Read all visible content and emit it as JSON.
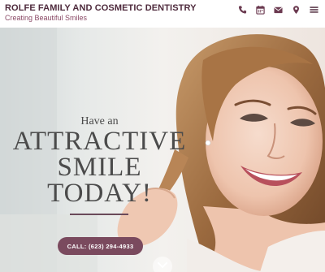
{
  "header": {
    "title": "ROLFE FAMILY AND COSMETIC DENTISTRY",
    "tagline": "Creating Beautiful Smiles",
    "icons": [
      "phone-icon",
      "calendar-icon",
      "envelope-icon",
      "map-pin-icon",
      "menu-icon"
    ]
  },
  "hero": {
    "kicker": "Have an",
    "line1": "ATTRACTIVE",
    "line2": "SMILE",
    "line3": "TODAY!",
    "cta_label": "CALL:  (623) 294-4933",
    "scroll_icon": "chevron-down-icon"
  },
  "colors": {
    "brand": "#4e2a3c",
    "tagline": "#8a4a66",
    "cta_bg": "#7a4a5e",
    "headline_text": "#4b4b4b"
  }
}
